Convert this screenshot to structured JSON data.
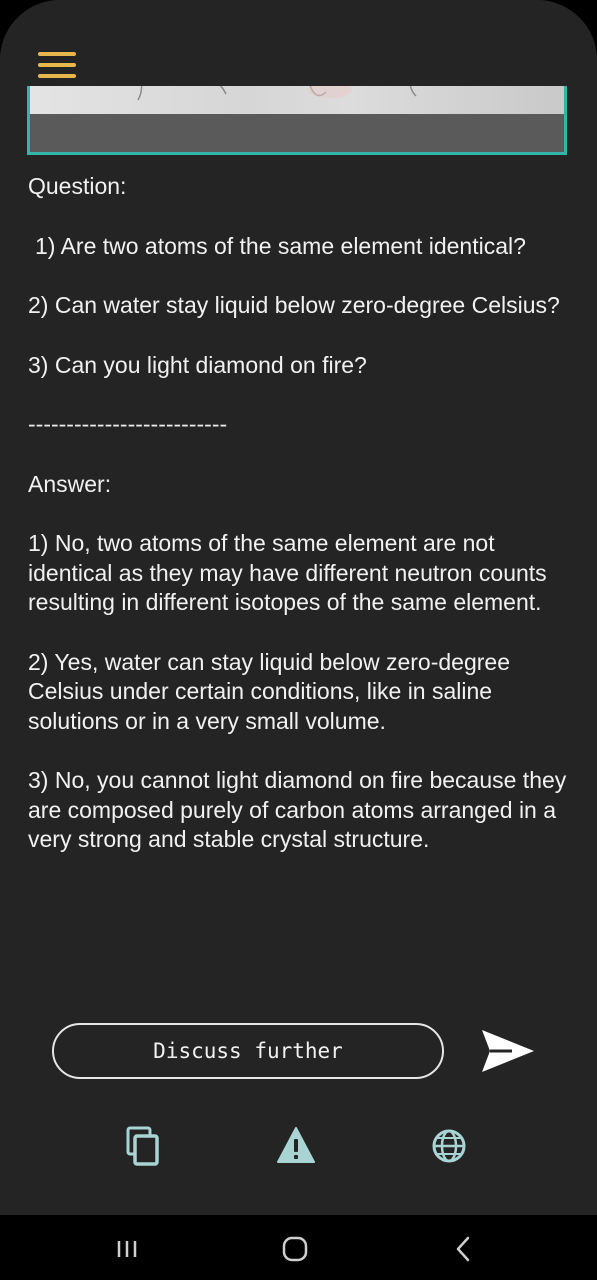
{
  "icons": {
    "menu": "hamburger-menu-icon",
    "send": "paper-plane-send-icon",
    "copy": "copy-icon",
    "report": "warning-triangle-icon",
    "language": "globe-icon",
    "nav_recents": "recents-icon",
    "nav_home": "home-icon",
    "nav_back": "back-chevron-icon"
  },
  "colors": {
    "background": "#242424",
    "accent": "#33b5a9",
    "icon_tint": "#a9d4d4",
    "menu_icon": "#e6b84c",
    "text": "#f1f1f1"
  },
  "content": {
    "question_label": "Question:",
    "questions": [
      "1) Are two atoms of the same element identical?",
      "2) Can water stay liquid below zero-degree Celsius?",
      "3) Can you light diamond on fire?"
    ],
    "divider": "--------------------------",
    "answer_label": "Answer:",
    "answers": [
      "1) No, two atoms of the same element are not identical as they may have different neutron counts resulting in different isotopes of the same element.",
      "2) Yes, water can stay liquid below zero-degree Celsius under certain conditions, like in saline solutions or in a very small volume.",
      "3) No, you cannot light diamond on fire because they are composed purely of carbon atoms arranged in a very strong and stable crystal structure."
    ]
  },
  "input": {
    "label": "Discuss further"
  }
}
